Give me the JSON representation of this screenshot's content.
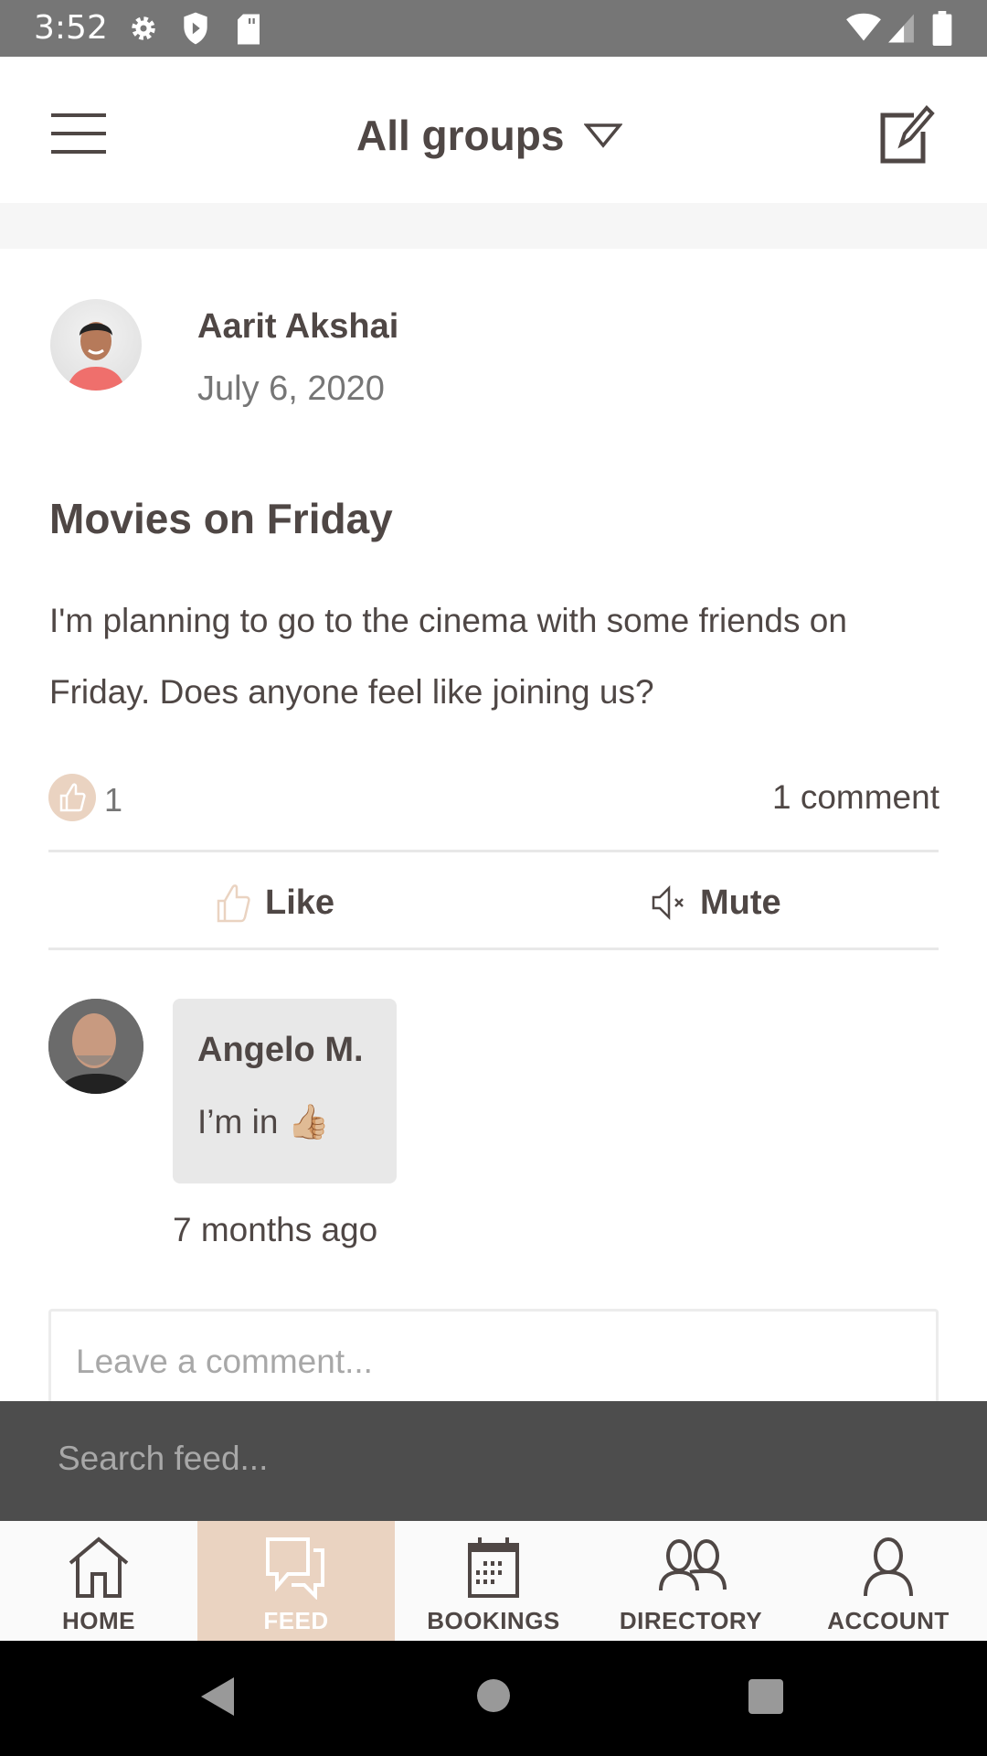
{
  "status_bar": {
    "time": "3:52",
    "icons": [
      "gear-icon",
      "shield-play-icon",
      "sd-card-icon",
      "wifi-icon",
      "signal-icon",
      "battery-icon"
    ]
  },
  "header": {
    "menu_icon": "hamburger-icon",
    "group_selector": "All groups",
    "compose_icon": "compose-icon"
  },
  "post": {
    "author": "Aarit Akshai",
    "date": "July 6, 2020",
    "title": "Movies on Friday",
    "body": "I'm planning to go to the cinema with some friends on Friday. Does anyone feel like joining us?",
    "like_count": "1",
    "comment_count": "1 comment",
    "actions": {
      "like": "Like",
      "mute": "Mute"
    }
  },
  "comments": [
    {
      "author": "Angelo M.",
      "text": "I’m in 👍🏼",
      "time": "7 months ago"
    }
  ],
  "comment_input": {
    "placeholder": "Leave a comment..."
  },
  "search": {
    "placeholder": "Search feed..."
  },
  "bottom_nav": {
    "active": "FEED",
    "items": [
      {
        "label": "HOME",
        "icon": "home-icon"
      },
      {
        "label": "FEED",
        "icon": "chat-icon"
      },
      {
        "label": "BOOKINGS",
        "icon": "calendar-icon"
      },
      {
        "label": "DIRECTORY",
        "icon": "people-icon"
      },
      {
        "label": "ACCOUNT",
        "icon": "person-icon"
      }
    ]
  },
  "colors": {
    "accent": "#ead3c1",
    "text": "#4f4745",
    "search_bar": "#4d4d4d"
  }
}
